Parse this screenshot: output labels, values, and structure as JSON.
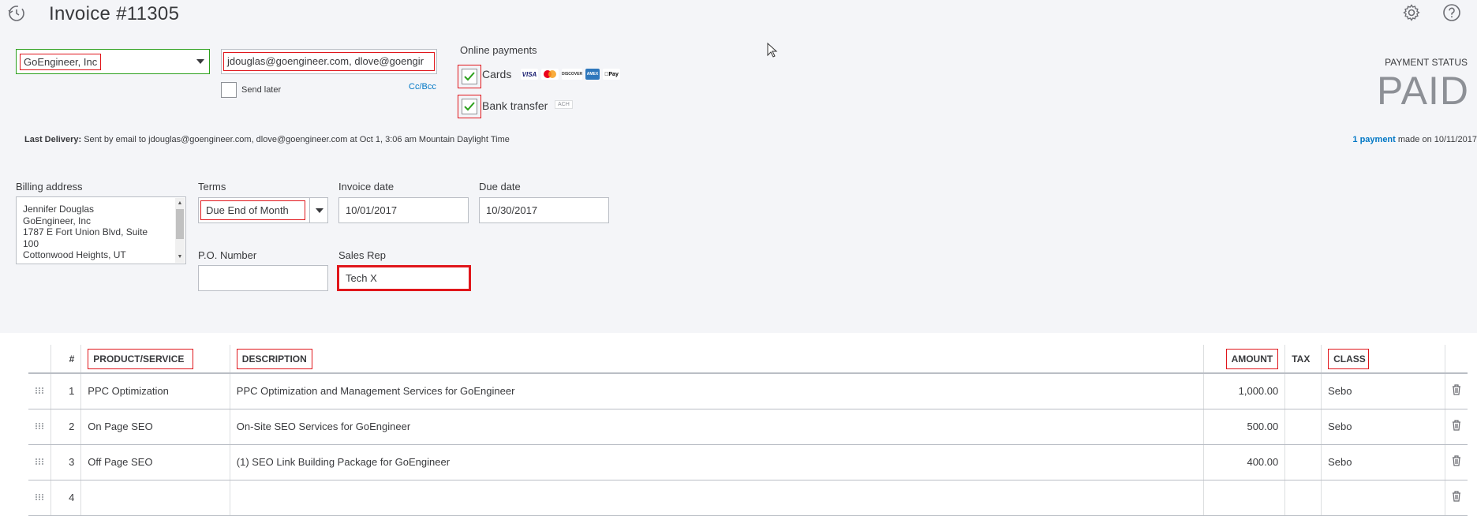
{
  "header": {
    "title": "Invoice #11305"
  },
  "customer": {
    "value": "GoEngineer, Inc"
  },
  "email": {
    "value": "jdouglas@goengineer.com, dlove@goengir",
    "send_later_label": "Send later",
    "cc_bcc": "Cc/Bcc"
  },
  "online_payments": {
    "label": "Online payments",
    "cards_label": "Cards",
    "bank_label": "Bank transfer",
    "ach": "ACH",
    "card_brands": [
      "VISA",
      "mc",
      "DISCOVER",
      "AMEX",
      "Pay"
    ]
  },
  "payment_status": {
    "label": "PAYMENT STATUS",
    "value": "PAID",
    "payment_link": "1 payment",
    "made_on": "made on 10/11/2017"
  },
  "last_delivery": {
    "label": "Last Delivery:",
    "text": "Sent by email to jdouglas@goengineer.com, dlove@goengineer.com at Oct 1, 3:06 am Mountain Daylight Time"
  },
  "billing": {
    "label": "Billing address",
    "lines": [
      "Jennifer Douglas",
      "GoEngineer, Inc",
      "1787 E Fort Union Blvd, Suite",
      "100",
      "Cottonwood Heights, UT"
    ]
  },
  "terms": {
    "label": "Terms",
    "value": "Due End of Month"
  },
  "invoice_date": {
    "label": "Invoice date",
    "value": "10/01/2017"
  },
  "due_date": {
    "label": "Due date",
    "value": "10/30/2017"
  },
  "po": {
    "label": "P.O. Number",
    "value": ""
  },
  "sales_rep": {
    "label": "Sales Rep",
    "value": "Tech X"
  },
  "table": {
    "headers": {
      "num": "#",
      "product": "PRODUCT/SERVICE",
      "description": "DESCRIPTION",
      "amount": "AMOUNT",
      "tax": "TAX",
      "class": "CLASS"
    },
    "rows": [
      {
        "num": "1",
        "product": "PPC Optimization",
        "description": "PPC Optimization and Management Services for GoEngineer",
        "amount": "1,000.00",
        "tax": "",
        "class": "Sebo"
      },
      {
        "num": "2",
        "product": "On Page SEO",
        "description": "On-Site SEO Services for GoEngineer",
        "amount": "500.00",
        "tax": "",
        "class": "Sebo"
      },
      {
        "num": "3",
        "product": "Off Page SEO",
        "description": "(1) SEO Link Building Package for GoEngineer",
        "amount": "400.00",
        "tax": "",
        "class": "Sebo"
      },
      {
        "num": "4",
        "product": "",
        "description": "",
        "amount": "",
        "tax": "",
        "class": ""
      }
    ]
  },
  "colors": {
    "accent": "#0077c5",
    "check": "#2ca01c",
    "highlight": "#e0161b"
  }
}
